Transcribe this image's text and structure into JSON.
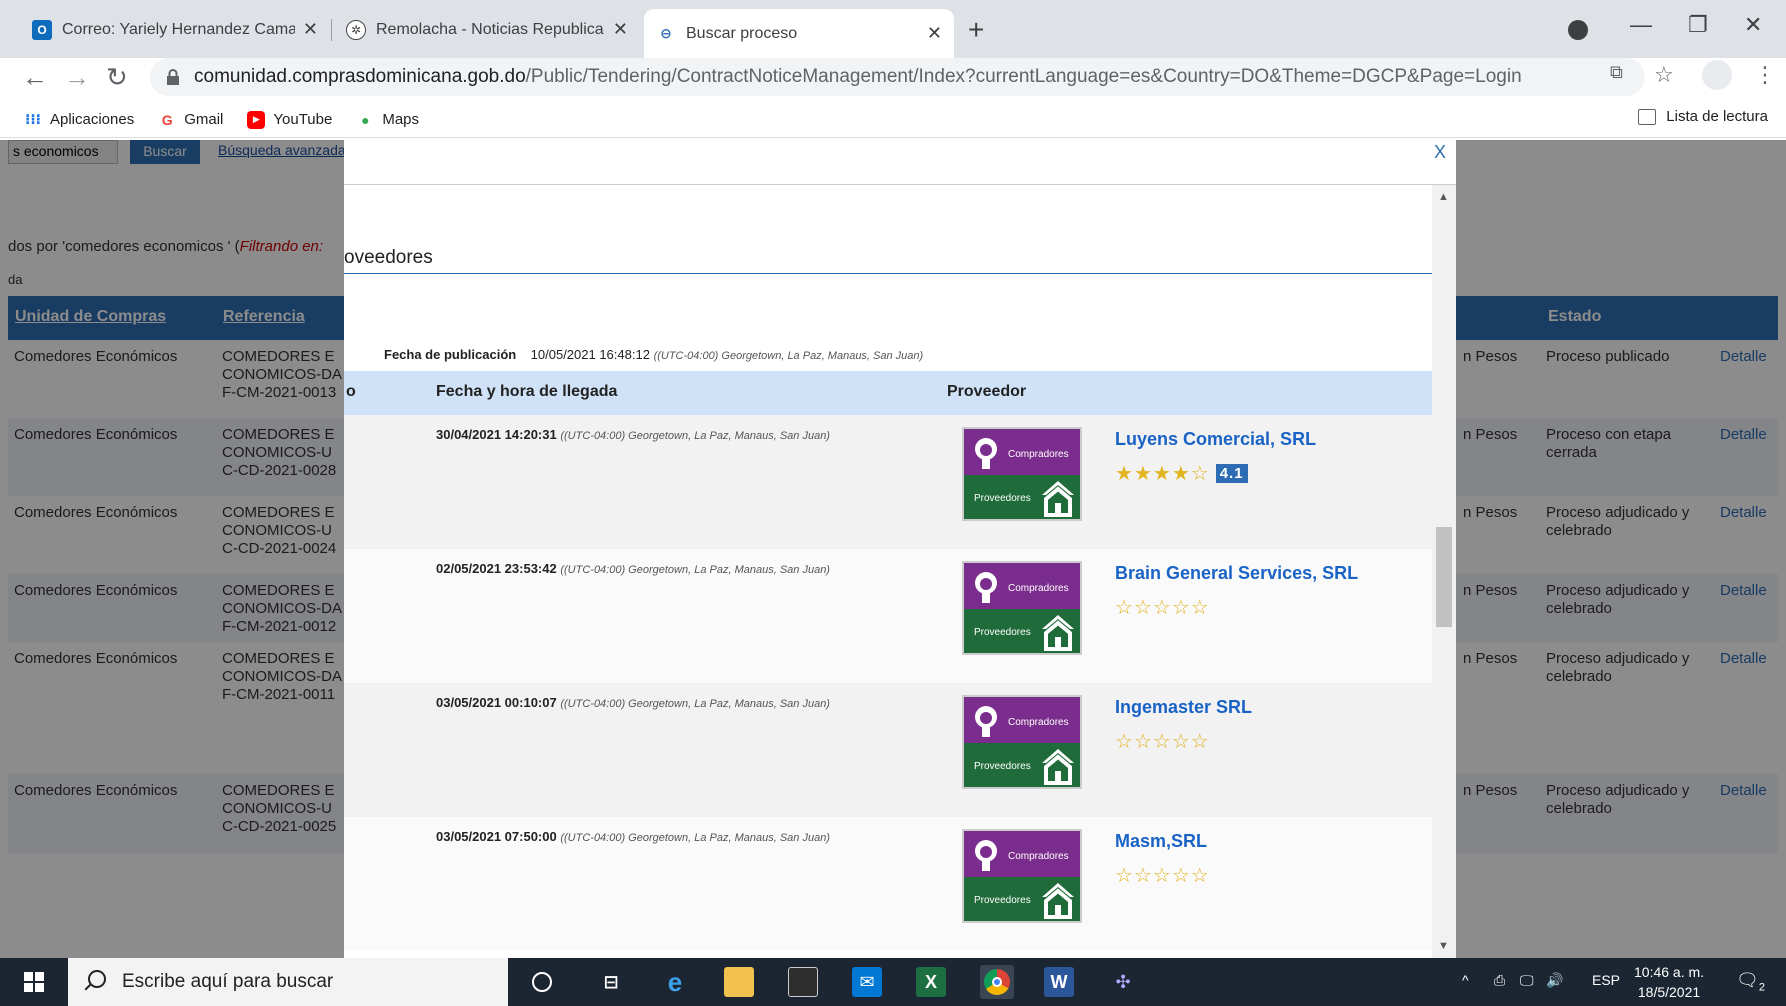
{
  "browser": {
    "tabs": [
      {
        "title": "Correo: Yariely Hernandez Camac",
        "favicon": "outlook-icon",
        "color": "#0f6cbd"
      },
      {
        "title": "Remolacha - Noticias Republica D",
        "favicon": "remolacha-icon",
        "color": "#444444"
      },
      {
        "title": "Buscar proceso",
        "favicon": "dgcp-icon",
        "color": "#2e6db4"
      }
    ],
    "address": {
      "host": "comunidad.comprasdominicana.gob.do",
      "path": "/Public/Tendering/ContractNoticeManagement/Index?currentLanguage=es&Country=DO&Theme=DGCP&Page=Login"
    },
    "bookmarks": [
      "Aplicaciones",
      "Gmail",
      "YouTube",
      "Maps"
    ],
    "reading_list": "Lista de lectura"
  },
  "background": {
    "search_value": "s economicos",
    "search_button": "Buscar",
    "advanced_link": "Búsqueda avanzada",
    "results_text": "dos por 'comedores economicos ' (",
    "results_filter": "Filtrando en:",
    "sub_text": "da",
    "headers": {
      "unit": "Unidad de Compras",
      "ref": "Referencia",
      "estado": "Estado"
    },
    "rows": [
      {
        "unit": "Comedores Económicos",
        "ref": "COMEDORES ECONOMICOS-DAF-CM-2021-0013",
        "currency": "n Pesos",
        "status": "Proceso publicado",
        "link": "Detalle"
      },
      {
        "unit": "Comedores Económicos",
        "ref": "COMEDORES ECONOMICOS-UC-CD-2021-0028",
        "currency": "n Pesos",
        "status": "Proceso con etapa cerrada",
        "link": "Detalle"
      },
      {
        "unit": "Comedores Económicos",
        "ref": "COMEDORES ECONOMICOS-UC-CD-2021-0024",
        "currency": "n Pesos",
        "status": "Proceso adjudicado y celebrado",
        "link": "Detalle"
      },
      {
        "unit": "Comedores Económicos",
        "ref": "COMEDORES ECONOMICOS-DAF-CM-2021-0012",
        "currency": "n Pesos",
        "status": "Proceso adjudicado y celebrado",
        "link": "Detalle"
      },
      {
        "unit": "Comedores Económicos",
        "ref": "COMEDORES ECONOMICOS-DAF-CM-2021-0011",
        "currency": "n Pesos",
        "status": "Proceso adjudicado y celebrado",
        "link": "Detalle"
      },
      {
        "unit": "Comedores Económicos",
        "ref": "COMEDORES ECONOMICOS-UC-CD-2021-0025",
        "currency": "n Pesos",
        "status": "Proceso adjudicado y celebrado",
        "link": "Detalle"
      }
    ]
  },
  "modal": {
    "close": "X",
    "title": "oveedores",
    "pub_label": "Fecha de publicación",
    "pub_value": "10/05/2021 16:48:12",
    "pub_tz": "((UTC-04:00) Georgetown, La Paz, Manaus, San Juan)",
    "col_o": "o",
    "col_arrival": "Fecha y hora de llegada",
    "col_supplier": "Proveedor",
    "badge_top": "Compradores",
    "badge_bottom": "Proveedores",
    "suppliers": [
      {
        "date": "30/04/2021 14:20:31",
        "tz": "((UTC-04:00) Georgetown, La Paz, Manaus, San Juan)",
        "name": "Luyens Comercial, SRL",
        "stars": 4,
        "rating": "4.1"
      },
      {
        "date": "02/05/2021 23:53:42",
        "tz": "((UTC-04:00) Georgetown, La Paz, Manaus, San Juan)",
        "name": "Brain General Services, SRL",
        "stars": 0,
        "rating": ""
      },
      {
        "date": "03/05/2021 00:10:07",
        "tz": "((UTC-04:00) Georgetown, La Paz, Manaus, San Juan)",
        "name": "Ingemaster SRL",
        "stars": 0,
        "rating": ""
      },
      {
        "date": "03/05/2021 07:50:00",
        "tz": "((UTC-04:00) Georgetown, La Paz, Manaus, San Juan)",
        "name": "Masm,SRL",
        "stars": 0,
        "rating": ""
      }
    ]
  },
  "taskbar": {
    "search_placeholder": "Escribe aquí para buscar",
    "lang": "ESP",
    "time": "10:46 a. m.",
    "date": "18/5/2021",
    "notif_count": "2"
  }
}
